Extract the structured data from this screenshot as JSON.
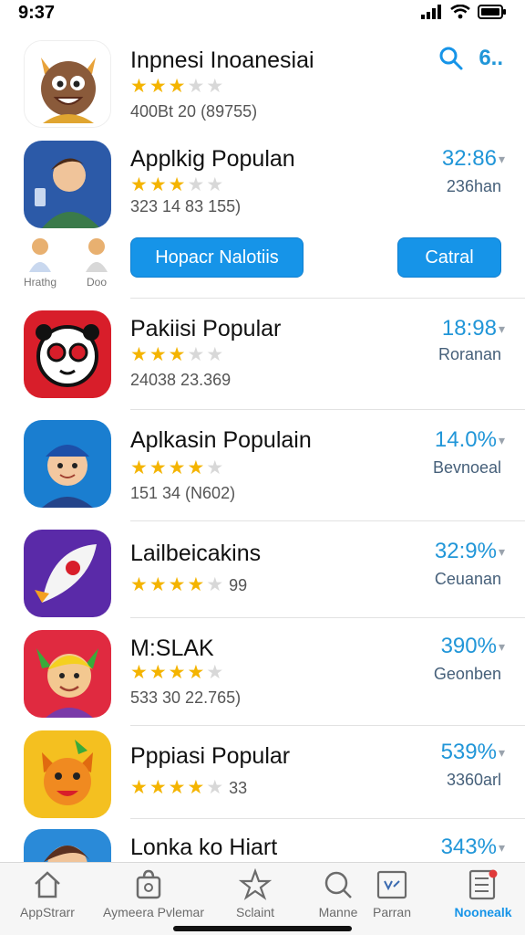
{
  "status_bar": {
    "time": "9:37"
  },
  "header": {
    "more_label": "6.."
  },
  "apps": [
    {
      "title": "Inpnesi Inoanesiai",
      "stars": 3,
      "meta": "400Bt 20 (89755)",
      "right_value": "",
      "right_sub": ""
    },
    {
      "title": "Applkig Populan",
      "stars": 3.5,
      "meta": "323 14 83 155)",
      "right_value": "32:86",
      "right_sub": "236han"
    },
    {
      "title": "Pakiisi Popular",
      "stars": 3,
      "meta": "24038 23.369",
      "right_value": "18:98",
      "right_sub": "Roranan"
    },
    {
      "title": "Aplkasin Populain",
      "stars": 4,
      "meta": "151 34 (N602)",
      "right_value": "14.0%",
      "right_sub": "Bevnoeal"
    },
    {
      "title": "Lailbeicakins",
      "stars": 4,
      "stars_count": "99",
      "meta": "",
      "right_value": "32:9%",
      "right_sub": "Ceuanan"
    },
    {
      "title": "M:SLAK",
      "stars": 4,
      "meta": "533 30 22.765)",
      "right_value": "390%",
      "right_sub": "Geonben"
    },
    {
      "title": "Pppiasi Popular",
      "stars": 4,
      "stars_count": "33",
      "meta": "",
      "right_value": "539%",
      "right_sub": "3360arl"
    },
    {
      "title": "Lonka ko Hiart",
      "stars": 0,
      "meta": "",
      "right_value": "343%",
      "right_sub": ""
    }
  ],
  "mini_avatars": [
    {
      "label": "Hrathg"
    },
    {
      "label": "Doo"
    }
  ],
  "buttons": {
    "primary": "Hopacr Nalotiis",
    "secondary": "Catral"
  },
  "tabs": [
    {
      "label": "AppStrarr",
      "icon": "home-icon"
    },
    {
      "label": "Aymeera Pvlemar",
      "icon": "bag-icon"
    },
    {
      "label": "Sclaint",
      "icon": "star-icon"
    },
    {
      "label": "Manne",
      "icon": "search-icon"
    },
    {
      "label": "Parran",
      "icon": "arcade-icon"
    },
    {
      "label": "Noonealk",
      "icon": "list-icon"
    }
  ],
  "colors": {
    "accent": "#1694e8",
    "star": "#f4b400"
  }
}
